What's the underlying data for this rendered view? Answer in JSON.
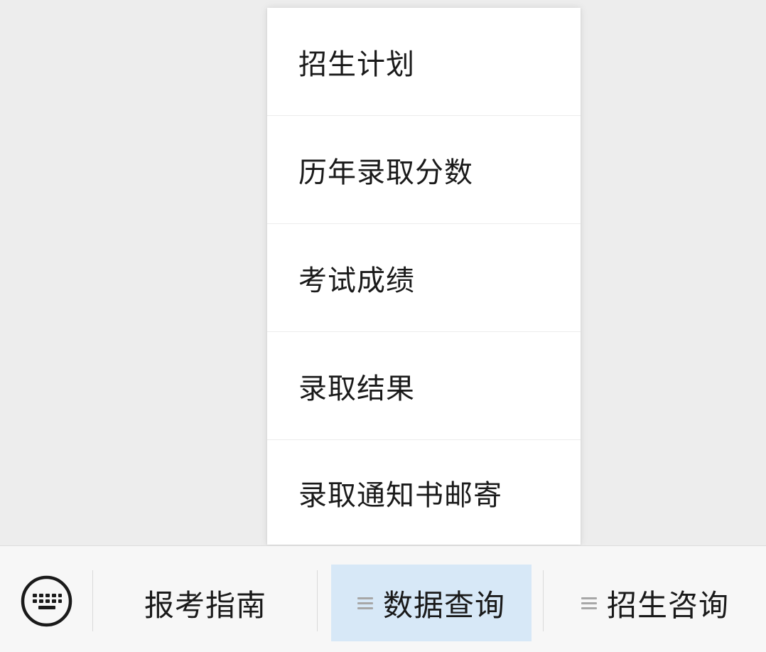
{
  "popup_menu": {
    "items": [
      {
        "label": "招生计划"
      },
      {
        "label": "历年录取分数"
      },
      {
        "label": "考试成绩"
      },
      {
        "label": "录取结果"
      },
      {
        "label": "录取通知书邮寄"
      }
    ]
  },
  "bottom_bar": {
    "keyboard_icon": "keyboard-icon",
    "tabs": [
      {
        "label": "报考指南",
        "has_submenu": false,
        "active": false
      },
      {
        "label": "数据查询",
        "has_submenu": true,
        "active": true,
        "submenu_icon": "menu-icon"
      },
      {
        "label": "招生咨询",
        "has_submenu": true,
        "active": false,
        "submenu_icon": "menu-icon"
      }
    ]
  },
  "colors": {
    "background": "#ededed",
    "menu_background": "#ffffff",
    "bar_background": "#f7f7f7",
    "active_tab": "#d7e8f7",
    "text": "#1a1a1a",
    "icon_gray": "#a7a7a7"
  }
}
